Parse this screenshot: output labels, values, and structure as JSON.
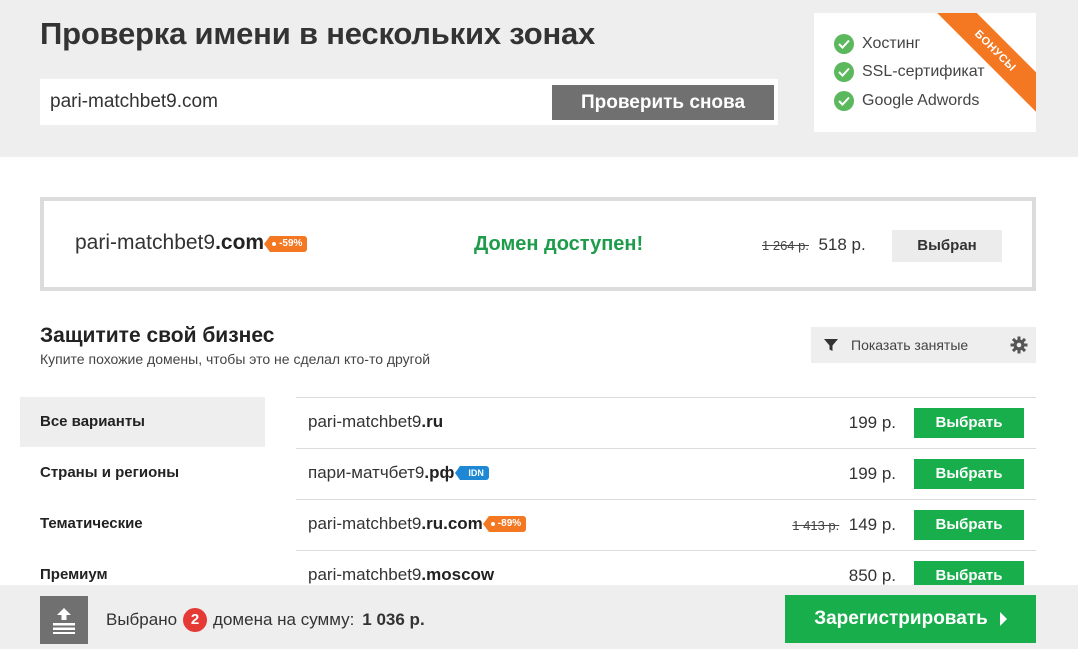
{
  "header": {
    "title": "Проверка имени в нескольких зонах",
    "search_value": "pari-matchbet9.com",
    "recheck_label": "Проверить снова"
  },
  "bonus": {
    "ribbon": "БОНУСЫ",
    "items": [
      "Хостинг",
      "SSL-сертификат",
      "Google Adwords"
    ]
  },
  "main_result": {
    "name": "pari-matchbet9",
    "zone": ".com",
    "discount": "-59%",
    "status": "Домен доступен!",
    "old_price": "1 264 р.",
    "price": "518 р.",
    "button": "Выбран"
  },
  "protect": {
    "title": "Защитите свой бизнес",
    "subtitle": "Купите похожие домены, чтобы это не сделал кто-то другой",
    "show_taken": "Показать занятые"
  },
  "sidebar": {
    "items": [
      "Все варианты",
      "Страны и регионы",
      "Тематические",
      "Премиум"
    ]
  },
  "rows": [
    {
      "name": "pari-matchbet9",
      "zone": ".ru",
      "price": "199 р.",
      "button": "Выбрать"
    },
    {
      "name": "пари-матчбет9",
      "zone": ".рф",
      "badge": "IDN",
      "price": "199 р.",
      "button": "Выбрать"
    },
    {
      "name": "pari-matchbet9",
      "zone": ".ru.com",
      "discount": "-89%",
      "old_price": "1 413 р.",
      "price": "149 р.",
      "button": "Выбрать"
    },
    {
      "name": "pari-matchbet9",
      "zone": ".moscow",
      "price": "850 р.",
      "button": "Выбрать"
    }
  ],
  "footer": {
    "selected_prefix": "Выбрано",
    "count": "2",
    "selected_suffix": "домена на сумму:",
    "total": "1 036 р.",
    "register": "Зарегистрировать"
  },
  "colors": {
    "accent_green": "#19ae4c",
    "status_green": "#1e9c4b",
    "discount_orange": "#f47721",
    "badge_red": "#e53935",
    "idn_blue": "#1e88d4"
  }
}
